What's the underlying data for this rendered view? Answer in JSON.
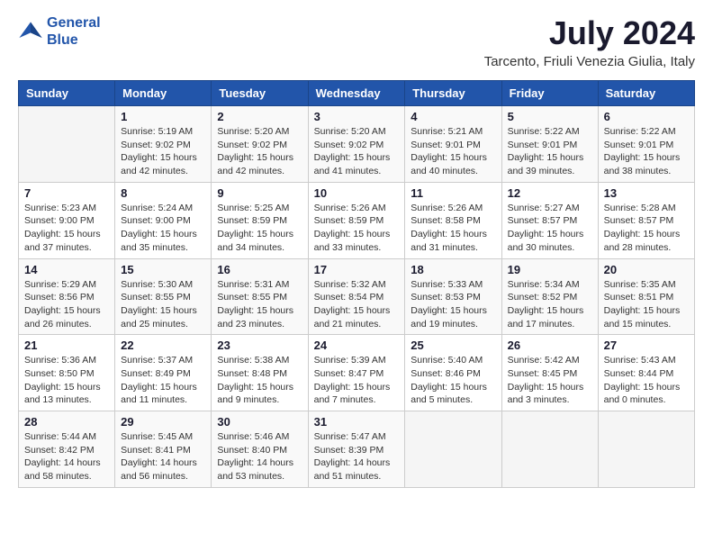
{
  "header": {
    "logo_line1": "General",
    "logo_line2": "Blue",
    "title": "July 2024",
    "subtitle": "Tarcento, Friuli Venezia Giulia, Italy"
  },
  "days_of_week": [
    "Sunday",
    "Monday",
    "Tuesday",
    "Wednesday",
    "Thursday",
    "Friday",
    "Saturday"
  ],
  "weeks": [
    [
      {
        "day": "",
        "info": ""
      },
      {
        "day": "1",
        "info": "Sunrise: 5:19 AM\nSunset: 9:02 PM\nDaylight: 15 hours\nand 42 minutes."
      },
      {
        "day": "2",
        "info": "Sunrise: 5:20 AM\nSunset: 9:02 PM\nDaylight: 15 hours\nand 42 minutes."
      },
      {
        "day": "3",
        "info": "Sunrise: 5:20 AM\nSunset: 9:02 PM\nDaylight: 15 hours\nand 41 minutes."
      },
      {
        "day": "4",
        "info": "Sunrise: 5:21 AM\nSunset: 9:01 PM\nDaylight: 15 hours\nand 40 minutes."
      },
      {
        "day": "5",
        "info": "Sunrise: 5:22 AM\nSunset: 9:01 PM\nDaylight: 15 hours\nand 39 minutes."
      },
      {
        "day": "6",
        "info": "Sunrise: 5:22 AM\nSunset: 9:01 PM\nDaylight: 15 hours\nand 38 minutes."
      }
    ],
    [
      {
        "day": "7",
        "info": "Sunrise: 5:23 AM\nSunset: 9:00 PM\nDaylight: 15 hours\nand 37 minutes."
      },
      {
        "day": "8",
        "info": "Sunrise: 5:24 AM\nSunset: 9:00 PM\nDaylight: 15 hours\nand 35 minutes."
      },
      {
        "day": "9",
        "info": "Sunrise: 5:25 AM\nSunset: 8:59 PM\nDaylight: 15 hours\nand 34 minutes."
      },
      {
        "day": "10",
        "info": "Sunrise: 5:26 AM\nSunset: 8:59 PM\nDaylight: 15 hours\nand 33 minutes."
      },
      {
        "day": "11",
        "info": "Sunrise: 5:26 AM\nSunset: 8:58 PM\nDaylight: 15 hours\nand 31 minutes."
      },
      {
        "day": "12",
        "info": "Sunrise: 5:27 AM\nSunset: 8:57 PM\nDaylight: 15 hours\nand 30 minutes."
      },
      {
        "day": "13",
        "info": "Sunrise: 5:28 AM\nSunset: 8:57 PM\nDaylight: 15 hours\nand 28 minutes."
      }
    ],
    [
      {
        "day": "14",
        "info": "Sunrise: 5:29 AM\nSunset: 8:56 PM\nDaylight: 15 hours\nand 26 minutes."
      },
      {
        "day": "15",
        "info": "Sunrise: 5:30 AM\nSunset: 8:55 PM\nDaylight: 15 hours\nand 25 minutes."
      },
      {
        "day": "16",
        "info": "Sunrise: 5:31 AM\nSunset: 8:55 PM\nDaylight: 15 hours\nand 23 minutes."
      },
      {
        "day": "17",
        "info": "Sunrise: 5:32 AM\nSunset: 8:54 PM\nDaylight: 15 hours\nand 21 minutes."
      },
      {
        "day": "18",
        "info": "Sunrise: 5:33 AM\nSunset: 8:53 PM\nDaylight: 15 hours\nand 19 minutes."
      },
      {
        "day": "19",
        "info": "Sunrise: 5:34 AM\nSunset: 8:52 PM\nDaylight: 15 hours\nand 17 minutes."
      },
      {
        "day": "20",
        "info": "Sunrise: 5:35 AM\nSunset: 8:51 PM\nDaylight: 15 hours\nand 15 minutes."
      }
    ],
    [
      {
        "day": "21",
        "info": "Sunrise: 5:36 AM\nSunset: 8:50 PM\nDaylight: 15 hours\nand 13 minutes."
      },
      {
        "day": "22",
        "info": "Sunrise: 5:37 AM\nSunset: 8:49 PM\nDaylight: 15 hours\nand 11 minutes."
      },
      {
        "day": "23",
        "info": "Sunrise: 5:38 AM\nSunset: 8:48 PM\nDaylight: 15 hours\nand 9 minutes."
      },
      {
        "day": "24",
        "info": "Sunrise: 5:39 AM\nSunset: 8:47 PM\nDaylight: 15 hours\nand 7 minutes."
      },
      {
        "day": "25",
        "info": "Sunrise: 5:40 AM\nSunset: 8:46 PM\nDaylight: 15 hours\nand 5 minutes."
      },
      {
        "day": "26",
        "info": "Sunrise: 5:42 AM\nSunset: 8:45 PM\nDaylight: 15 hours\nand 3 minutes."
      },
      {
        "day": "27",
        "info": "Sunrise: 5:43 AM\nSunset: 8:44 PM\nDaylight: 15 hours\nand 0 minutes."
      }
    ],
    [
      {
        "day": "28",
        "info": "Sunrise: 5:44 AM\nSunset: 8:42 PM\nDaylight: 14 hours\nand 58 minutes."
      },
      {
        "day": "29",
        "info": "Sunrise: 5:45 AM\nSunset: 8:41 PM\nDaylight: 14 hours\nand 56 minutes."
      },
      {
        "day": "30",
        "info": "Sunrise: 5:46 AM\nSunset: 8:40 PM\nDaylight: 14 hours\nand 53 minutes."
      },
      {
        "day": "31",
        "info": "Sunrise: 5:47 AM\nSunset: 8:39 PM\nDaylight: 14 hours\nand 51 minutes."
      },
      {
        "day": "",
        "info": ""
      },
      {
        "day": "",
        "info": ""
      },
      {
        "day": "",
        "info": ""
      }
    ]
  ]
}
